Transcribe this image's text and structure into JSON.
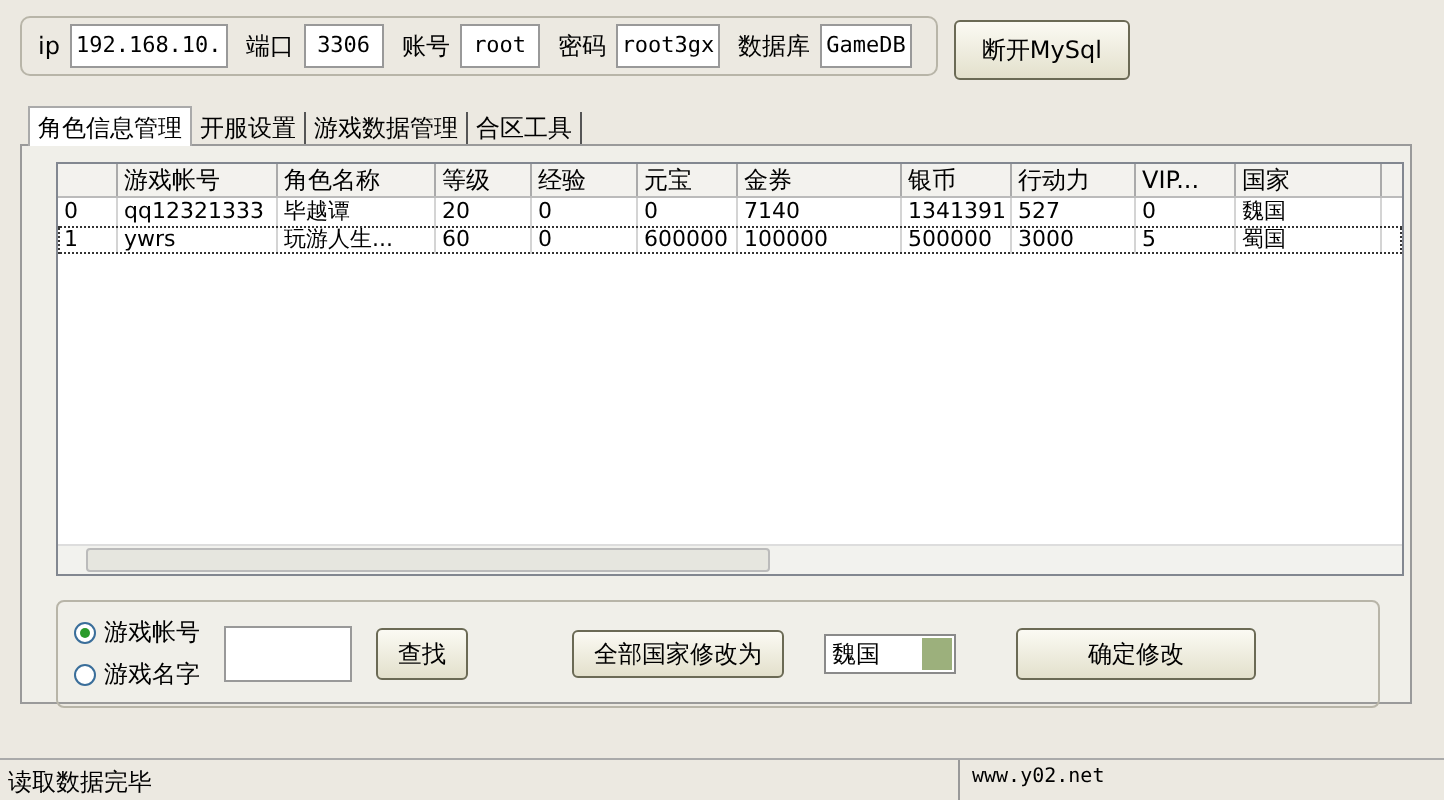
{
  "connection": {
    "fields": [
      {
        "label": "ip",
        "value": "192.168.10."
      },
      {
        "label": "端口",
        "value": "3306"
      },
      {
        "label": "账号",
        "value": "root"
      },
      {
        "label": "密码",
        "value": "root3gx"
      },
      {
        "label": "数据库",
        "value": "GameDB"
      }
    ],
    "button": "断开MySql"
  },
  "tabs": [
    {
      "label": "角色信息管理",
      "selected": true
    },
    {
      "label": "开服设置",
      "selected": false
    },
    {
      "label": "游戏数据管理",
      "selected": false
    },
    {
      "label": "合区工具",
      "selected": false
    }
  ],
  "table": {
    "columns": [
      "",
      "游戏帐号",
      "角色名称",
      "等级",
      "经验",
      "元宝",
      "金券",
      "银币",
      "行动力",
      "VIP...",
      "国家"
    ],
    "rows": [
      {
        "selected": false,
        "cells": [
          "0",
          "qq12321333",
          "毕越谭",
          "20",
          "0",
          "0",
          "7140",
          "1341391",
          "527",
          "0",
          "魏国"
        ]
      },
      {
        "selected": true,
        "cells": [
          "1",
          "ywrs",
          "玩游人生...",
          "60",
          "0",
          "600000",
          "100000",
          "500000",
          "3000",
          "5",
          "蜀国"
        ]
      }
    ]
  },
  "search": {
    "options": [
      {
        "label": "游戏帐号",
        "selected": true
      },
      {
        "label": "游戏名字",
        "selected": false
      }
    ],
    "button": "查找"
  },
  "bulk": {
    "button": "全部国家修改为",
    "dropdown": "魏国",
    "confirm": "确定修改"
  },
  "status_bar": {
    "message": "读取数据完毕",
    "panel": "www.y02.net"
  }
}
